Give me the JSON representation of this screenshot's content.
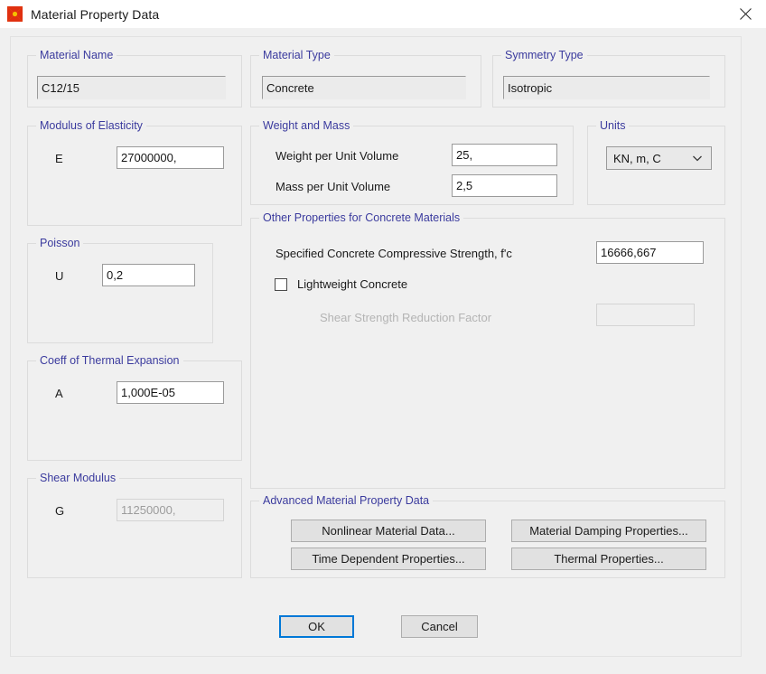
{
  "window": {
    "title": "Material Property Data",
    "icon": "sap-star-icon",
    "close_icon": "close-icon"
  },
  "material_name": {
    "label": "Material Name",
    "value": "C12/15"
  },
  "material_type": {
    "label": "Material Type",
    "value": "Concrete"
  },
  "symmetry_type": {
    "label": "Symmetry Type",
    "value": "Isotropic"
  },
  "modulus": {
    "label": "Modulus of Elasticity",
    "field_label": "E",
    "value": "27000000,"
  },
  "poisson": {
    "label": "Poisson",
    "field_label": "U",
    "value": "0,2"
  },
  "thermal": {
    "label": "Coeff of Thermal Expansion",
    "field_label": "A",
    "value": "1,000E-05"
  },
  "shear_modulus": {
    "label": "Shear Modulus",
    "field_label": "G",
    "value": "11250000,"
  },
  "weight_and_mass": {
    "label": "Weight and Mass",
    "weight_label": "Weight per Unit Volume",
    "weight_value": "25,",
    "mass_label": "Mass per Unit Volume",
    "mass_value": "2,5"
  },
  "units": {
    "label": "Units",
    "value": "KN, m, C",
    "chevron_icon": "chevron-down-icon"
  },
  "other_properties": {
    "label": "Other Properties for Concrete Materials",
    "fc_label": "Specified Concrete Compressive Strength, f'c",
    "fc_value": "16666,667",
    "lightweight_label": "Lightweight Concrete",
    "shear_reduction_label": "Shear Strength Reduction Factor",
    "shear_reduction_value": ""
  },
  "advanced": {
    "label": "Advanced Material Property Data",
    "nonlinear_button": "Nonlinear Material Data...",
    "damping_button": "Material Damping Properties...",
    "time_dependent_button": "Time Dependent Properties...",
    "thermal_button": "Thermal Properties..."
  },
  "footer": {
    "ok_button": "OK",
    "cancel_button": "Cancel"
  },
  "colors": {
    "group_label": "#3b3b9e",
    "dialog_bg": "#f0f0f0",
    "accent_focus": "#0078d7",
    "disabled_text": "#9c9c9c"
  }
}
